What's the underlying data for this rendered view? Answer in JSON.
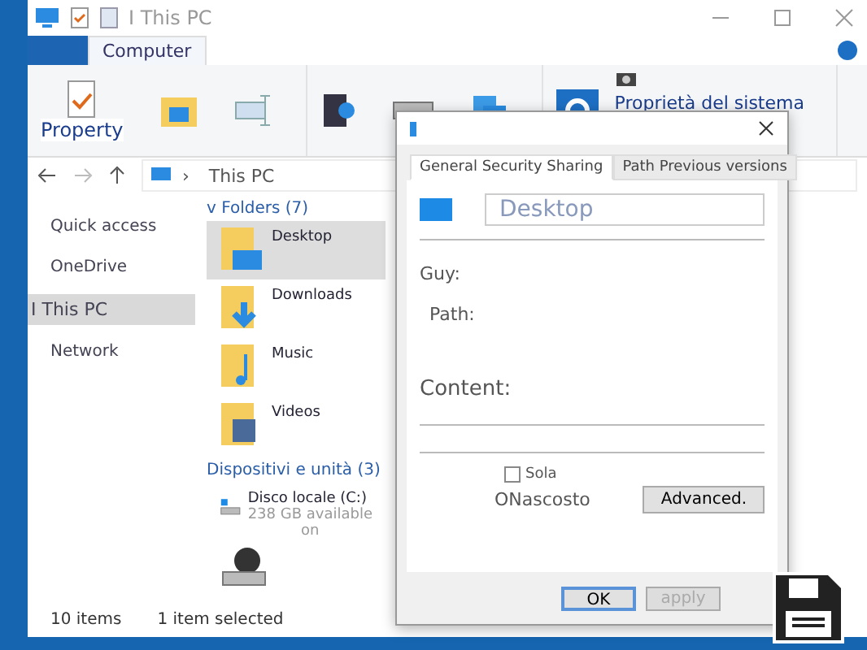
{
  "window": {
    "title": "I This PC"
  },
  "ribbon": {
    "tabs": [
      {
        "label": "Computer",
        "selected": true
      }
    ],
    "property_label": "Property",
    "system_label": "Proprietà del sistema"
  },
  "address": {
    "separator": "›",
    "path": "This PC"
  },
  "sidebar": {
    "items": [
      {
        "label": "Quick access",
        "selected": false
      },
      {
        "label": "OneDrive",
        "selected": false
      },
      {
        "label": "I This PC",
        "selected": true
      },
      {
        "label": "Network",
        "selected": false
      }
    ]
  },
  "groups": [
    {
      "title": "v Folders (7)",
      "items": [
        {
          "label": "Desktop",
          "kind": "desktop",
          "selected": true
        },
        {
          "label": "Downloads",
          "kind": "downloads",
          "selected": false
        },
        {
          "label": "Music",
          "kind": "music",
          "selected": false
        },
        {
          "label": "Videos",
          "kind": "videos",
          "selected": false
        }
      ]
    },
    {
      "title": "Dispositivi e unità (3)",
      "items": [
        {
          "label": "Disco locale (C:)",
          "kind": "drive",
          "detail": "238 GB available",
          "detail_2": "on",
          "selected": false
        },
        {
          "kind": "dvd",
          "selected": false
        }
      ]
    }
  ],
  "status_bar": {
    "count": "10 items",
    "selection": "1 item selected"
  },
  "dialog": {
    "tabs": [
      {
        "label": "General Security Sharing",
        "selected": true
      },
      {
        "label": "Path Previous versions",
        "selected": false
      }
    ],
    "name": "Desktop",
    "fields": [
      {
        "label": "Guy:"
      },
      {
        "label": "Path:"
      },
      {
        "label": "Content:"
      }
    ],
    "readonly_label": "Sola",
    "readonly_checked": false,
    "hidden_label": "ONascosto",
    "advanced": "Advanced.",
    "buttons": [
      {
        "label": "OK",
        "disabled": false,
        "default": true
      },
      {
        "label": "apply",
        "disabled": true,
        "default": false
      }
    ]
  }
}
